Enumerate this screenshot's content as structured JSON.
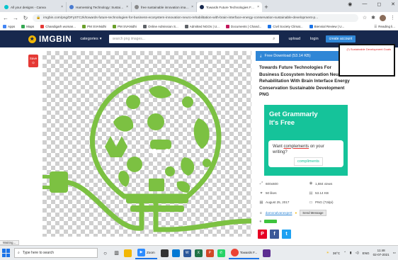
{
  "browser": {
    "tabs": [
      {
        "title": "All your designs - Canva",
        "color": "#00c4cc"
      },
      {
        "title": "Harnessing Technology: Sustaina...",
        "color": "#4a7bd0"
      },
      {
        "title": "free sustainable innovation imag...",
        "color": "#888888"
      },
      {
        "title": "Towards Future Technologies Fo...",
        "color": "#17284d"
      }
    ],
    "url": "imgbin.com/png/DFySTCzk/towards-future-technologies-for-business-ecosystem-innovation-neuro-rehabilitation-with-brain-interface-energy-conservation-sustainable-development-p...",
    "bookmarks": [
      {
        "label": "Apps",
        "color": "#4285f4"
      },
      {
        "label": "Maps",
        "color": "#34a853"
      },
      {
        "label": "Chandigarh woman...",
        "color": "#e53935"
      },
      {
        "label": "PM SVANidhi",
        "color": "#6a9f2a"
      },
      {
        "label": "PM SVANidhi",
        "color": "#6a9f2a"
      },
      {
        "label": "Online Admission S...",
        "color": "#5f6368"
      },
      {
        "label": "Admitted NGOs | U...",
        "color": "#5f6368"
      },
      {
        "label": "Documents | Chand...",
        "color": "#c2185b"
      },
      {
        "label": "Civil Society Climat...",
        "color": "#1a73e8"
      },
      {
        "label": "Biennial Review | U...",
        "color": "#1a73e8"
      }
    ],
    "reading_list": "Reading li..."
  },
  "site": {
    "logo": "IMGBIN",
    "categories": "categories",
    "search_placeholder": "search png images...",
    "upload": "upload",
    "login": "login",
    "create_account": "create account"
  },
  "popup_text": "(*) Sustainable Development Goals",
  "save_badge": "Save",
  "panel": {
    "download": "Free Download (53.14 KB)",
    "title": "Towards Future Technologies For Business Ecosystem Innovation Neuro-Rehabilitation With Brain Interface Energy Conservation Sustainable Development PNG",
    "ad_heading_1": "Get Grammarly",
    "ad_heading_2": "It's Free",
    "ad_text_1": "Want",
    "ad_text_2": "complements",
    "ad_text_3": "on your writing?",
    "ad_suggestion": "compliments",
    "meta": [
      {
        "icon": "resize-icon",
        "glyph": "⤢",
        "value": "600x600"
      },
      {
        "icon": "eye-icon",
        "glyph": "◉",
        "value": "1,884 views"
      },
      {
        "icon": "heart-icon",
        "glyph": "♥",
        "value": "50 likes"
      },
      {
        "icon": "file-icon",
        "glyph": "▤",
        "value": "53.14 KB"
      },
      {
        "icon": "calendar-icon",
        "glyph": "▦",
        "value": "August 25, 2017"
      },
      {
        "icon": "monitor-icon",
        "glyph": "▭",
        "value": "PNG (72dpi)"
      }
    ],
    "author": "damonalvanexpert",
    "send_message": "Send Message",
    "share": [
      {
        "name": "pinterest-icon",
        "glyph": "P",
        "color": "#e60023"
      },
      {
        "name": "facebook-icon",
        "glyph": "f",
        "color": "#3b5998"
      },
      {
        "name": "twitter-icon",
        "glyph": "t",
        "color": "#1da1f2"
      }
    ]
  },
  "status_text": "Waiting...",
  "taskbar": {
    "search_placeholder": "Type here to search",
    "zoom_label": "Zoom",
    "active_app_label": "Towards F...",
    "temperature": "36°C",
    "lang": "ENG",
    "time": "11:48",
    "date": "02-07-2021"
  },
  "colors": {
    "brand": "#17284d",
    "accent": "#2f86d6",
    "bulb": "#7cc142"
  }
}
